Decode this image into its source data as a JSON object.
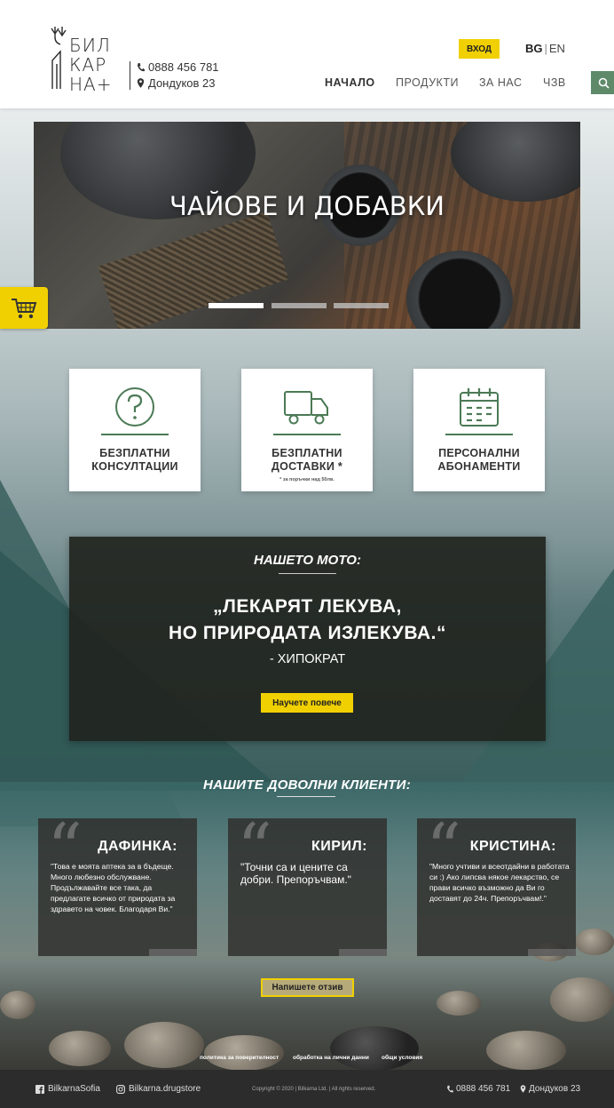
{
  "header": {
    "logo_lines": [
      "БИЛ",
      "КАР",
      "НА+"
    ],
    "phone": "0888 456 781",
    "address": "Дондуков 23",
    "login_label": "ВХОД",
    "lang_bg": "BG",
    "lang_sep": "|",
    "lang_en": "EN",
    "nav": [
      "НАЧАЛО",
      "ПРОДУКТИ",
      "ЗА НАС",
      "ЧЗВ"
    ],
    "active_nav": "НАЧАЛО"
  },
  "slider": {
    "title": "ЧАЙОВЕ И ДОБАВКИ",
    "dots": 3,
    "active_dot": 1
  },
  "features": [
    {
      "icon": "question-icon",
      "title": "БЕЗПЛАТНИ КОНСУЛТАЦИИ",
      "note": ""
    },
    {
      "icon": "truck-icon",
      "title": "БЕЗПЛАТНИ ДОСТАВКИ *",
      "note": "* за поръчки над 50лв."
    },
    {
      "icon": "calendar-icon",
      "title": "ПЕРСОНАЛНИ АБОНАМЕНТИ",
      "note": ""
    }
  ],
  "motto": {
    "label": "НАШЕТО МОТО:",
    "quote_line1": "„ЛЕКАРЯТ ЛЕКУВА,",
    "quote_line2": "НО ПРИРОДАТА ИЗЛЕКУВА.“",
    "author": "- ХИПОКРАТ",
    "button": "Научете повече"
  },
  "clients": {
    "title": "НАШИТЕ ДОВОЛНИ КЛИЕНТИ:",
    "items": [
      {
        "name": "ДАФИНКА:",
        "text": "\"Това е моята аптека за в бъдеще. Много любезно обслужване. Продължавайте все така, да предлагате всичко от природата за здравето на човек. Благодаря Ви.\""
      },
      {
        "name": "КИРИЛ:",
        "text": "\"Точни са и цените са добри. Препоръчвам.\""
      },
      {
        "name": "КРИСТИНА:",
        "text": "\"Много учтиви и всеотдайни в работата си :) Ако липсва някое лекарство, се прави всичко възможно да Ви го доставят до 24ч. Препоръчвам!.\""
      }
    ],
    "review_button": "Напишете отзив"
  },
  "links": [
    "политика за поверителност",
    "обработка на лични данни",
    "общи условия"
  ],
  "footer": {
    "facebook": "BilkarnaSofia",
    "instagram": "Bilkarna.drugstore",
    "copyright": "Copyright © 2020  |  Bilkarna Ltd.  |  All rights reserved.",
    "phone": "0888 456 781",
    "address": "Дондуков 23"
  },
  "colors": {
    "accent_yellow": "#f0d000",
    "green": "#4b7a55",
    "search_green": "#5e8a6a",
    "footer_bg": "#2c2c2c"
  }
}
